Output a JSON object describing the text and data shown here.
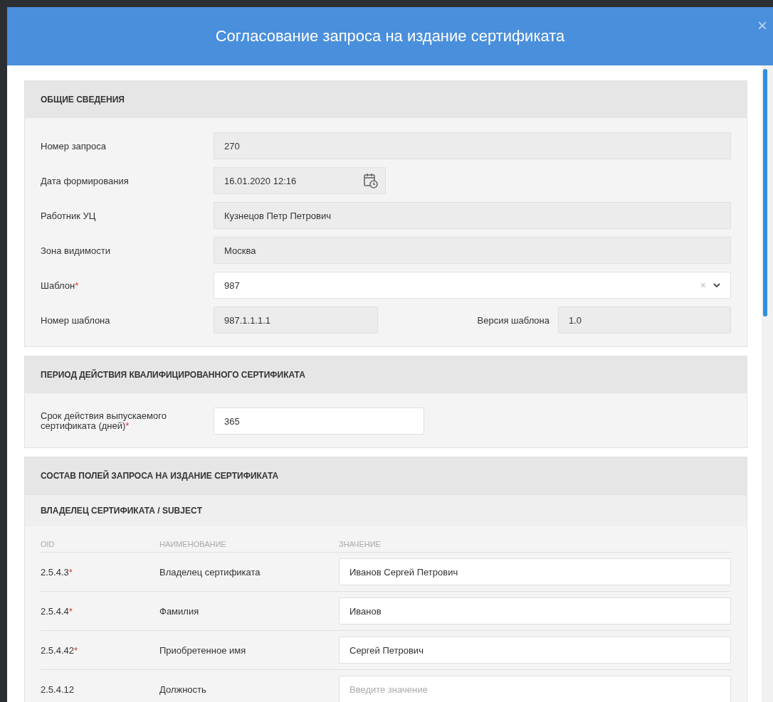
{
  "dialog": {
    "title": "Согласование запроса на издание сертификата",
    "close": "×"
  },
  "general": {
    "title": "ОБЩИЕ СВЕДЕНИЯ",
    "rows": [
      {
        "kind": "readonly",
        "label": "Номер запроса",
        "value": "270"
      },
      {
        "kind": "date",
        "label": "Дата формирования",
        "value": "16.01.2020 12:16"
      },
      {
        "kind": "readonly",
        "label": "Работник УЦ",
        "value": "Кузнецов Петр Петрович"
      },
      {
        "kind": "readonly",
        "label": "Зона видимости",
        "value": "Москва"
      },
      {
        "kind": "select",
        "label": "Шаблон",
        "required_mark": "*",
        "value": "987",
        "clear": "×"
      },
      {
        "kind": "split",
        "label": "Номер шаблона",
        "value": "987.1.1.1.1",
        "label2": "Версия шаблона",
        "value2": "1.0"
      }
    ]
  },
  "period": {
    "title": "ПЕРИОД ДЕЙСТВИЯ КВАЛИФИЦИРОВАННОГО СЕРТИФИКАТА",
    "rows": [
      {
        "kind": "input",
        "label": "Срок действия выпускаемого сертификата (дней)",
        "required_mark": "*",
        "value": "365"
      }
    ]
  },
  "fields": {
    "title": "СОСТАВ ПОЛЕЙ ЗАПРОСА НА ИЗДАНИЕ СЕРТИФИКАТА",
    "subtitle": "ВЛАДЕЛЕЦ СЕРТИФИКАТА / SUBJECT",
    "columns": [
      "OID",
      "НАИМЕНОВАНИЕ",
      "ЗНАЧЕНИЕ"
    ],
    "rows": [
      {
        "oid": "2.5.4.3",
        "required_mark": "*",
        "name": "Владелец сертификата",
        "value": "Иванов Сергей Петрович"
      },
      {
        "oid": "2.5.4.4",
        "required_mark": "*",
        "name": "Фамилия",
        "value": "Иванов"
      },
      {
        "oid": "2.5.4.42",
        "required_mark": "*",
        "name": "Приобретенное имя",
        "value": "Сергей Петрович"
      },
      {
        "oid": "2.5.4.12",
        "name": "Должность",
        "placeholder": "Введите значение"
      }
    ]
  }
}
